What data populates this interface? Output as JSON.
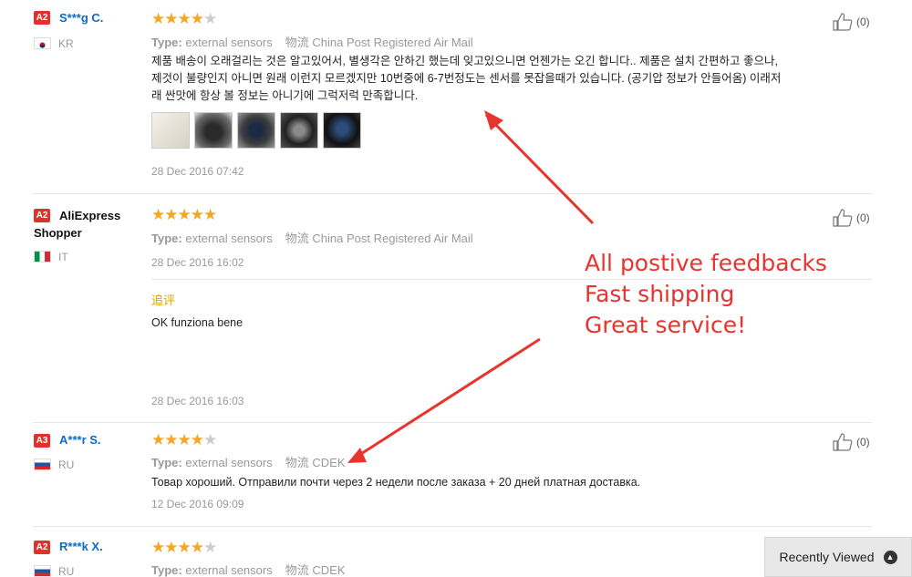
{
  "reviews": [
    {
      "level": "A2",
      "buyer": "S***g C.",
      "country": "KR",
      "rating": 4,
      "type_label": "Type:",
      "type_value": "external sensors",
      "logistics_label": "物流",
      "logistics_value": "China Post Registered Air Mail",
      "text_lines": [
        "제품 배송이 오래걸리는 것은 알고있어서, 별생각은 안하긴 했는데 잊고있으니면 언젠가는 오긴 합니다.. 제품은 설치 간편하고 좋으나,",
        "제것이 불량인지 아니면 원래 이런지 모르겠지만 10번중에 6-7번정도는 센서를 못잡을때가 있습니다. (공기압 정보가 안들어옴) 이래저",
        "래 싼맛에 항상 볼 정보는 아니기에 그럭저럭 만족합니다."
      ],
      "date": "28 Dec 2016 07:42",
      "likes": "(0)"
    },
    {
      "level": "A2",
      "buyer": "AliExpress Shopper",
      "buyer_line1": "AliExpress",
      "buyer_line2": "Shopper",
      "country": "IT",
      "rating": 5,
      "type_label": "Type:",
      "type_value": "external sensors",
      "logistics_label": "物流",
      "logistics_value": "China Post Registered Air Mail",
      "date": "28 Dec 2016 16:02",
      "append_label": "追评",
      "append_text": "OK funziona bene",
      "append_date": "28 Dec 2016 16:03",
      "likes": "(0)"
    },
    {
      "level": "A3",
      "buyer": "A***r S.",
      "country": "RU",
      "rating": 4,
      "type_label": "Type:",
      "type_value": "external sensors",
      "logistics_label": "物流",
      "logistics_value": "CDEK",
      "text": "Товар хороший. Отправили почти через 2 недели после заказа + 20 дней платная доставка.",
      "date": "12 Dec 2016 09:09",
      "likes": "(0)"
    },
    {
      "level": "A2",
      "buyer": "R***k X.",
      "country": "RU",
      "rating": 4,
      "type_label": "Type:",
      "type_value": "external sensors",
      "logistics_label": "物流",
      "logistics_value": "CDEK"
    }
  ],
  "annotation": {
    "lines": [
      "All postive feedbacks",
      "Fast shipping",
      "Great service!"
    ],
    "color": "#e8342f"
  },
  "recently_viewed": {
    "label": "Recently Viewed",
    "icon": "chevron-up-icon"
  },
  "colors": {
    "accent_blue": "#0a6cc4",
    "star": "#f5a623",
    "level_badge": "#e0322b"
  }
}
